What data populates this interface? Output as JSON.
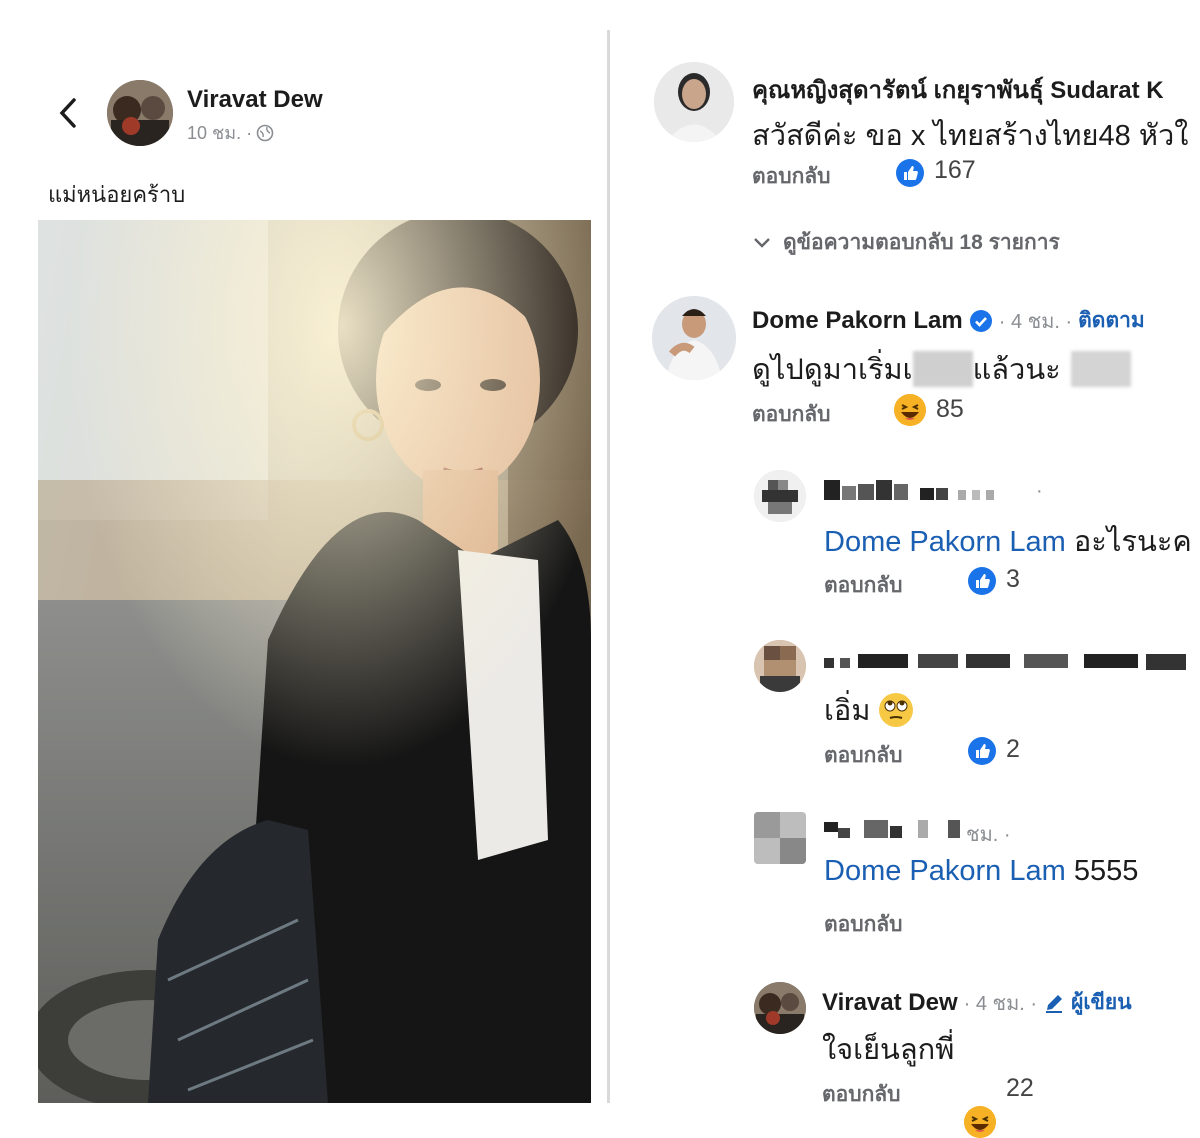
{
  "post": {
    "author": "Viravat Dew",
    "time": "10 ชม. ·",
    "caption": "แม่หน่อยคร้าบ"
  },
  "comments": [
    {
      "name": "คุณหญิงสุดารัตน์ เกยุราพันธุ์ Sudarat K",
      "text": "สวัสดีค่ะ ขอ x ไทยสร้างไทย48 หัวใ",
      "reply": "ตอบกลับ",
      "reaction": "like-icon",
      "count": "167"
    },
    {
      "view_replies": "ดูข้อความตอบกลับ 18 รายการ"
    },
    {
      "name": "Dome Pakorn Lam",
      "meta": "· 4 ชม. ·",
      "follow": "ติดตาม",
      "text_a": "ดูไปดูมาเริ่มเ",
      "text_b": "แล้วนะ",
      "reply": "ตอบกลับ",
      "reaction": "haha-icon",
      "count": "85"
    },
    {
      "meta": "·",
      "mention": "Dome Pakorn Lam",
      "text": "อะไรนะค",
      "reply": "ตอบกลับ",
      "reaction": "like-icon",
      "count": "3"
    },
    {
      "text": "เอิ่ม",
      "reply": "ตอบกลับ",
      "reaction": "like-icon",
      "count": "2"
    },
    {
      "meta": "ชม. ·",
      "mention": "Dome Pakorn Lam",
      "text": "5555",
      "reply": "ตอบกลับ"
    },
    {
      "name": "Viravat Dew",
      "meta": "· 4 ชม. ·",
      "badge": "ผู้เขียน",
      "text": "ใจเย็นลูกพี่",
      "reply": "ตอบกลับ",
      "reaction": "haha-icon",
      "count": "22"
    }
  ],
  "colors": {
    "mention": "#1b5fb3",
    "like": "#1a73e8",
    "haha": "#f7b125",
    "muted": "#65676b"
  }
}
